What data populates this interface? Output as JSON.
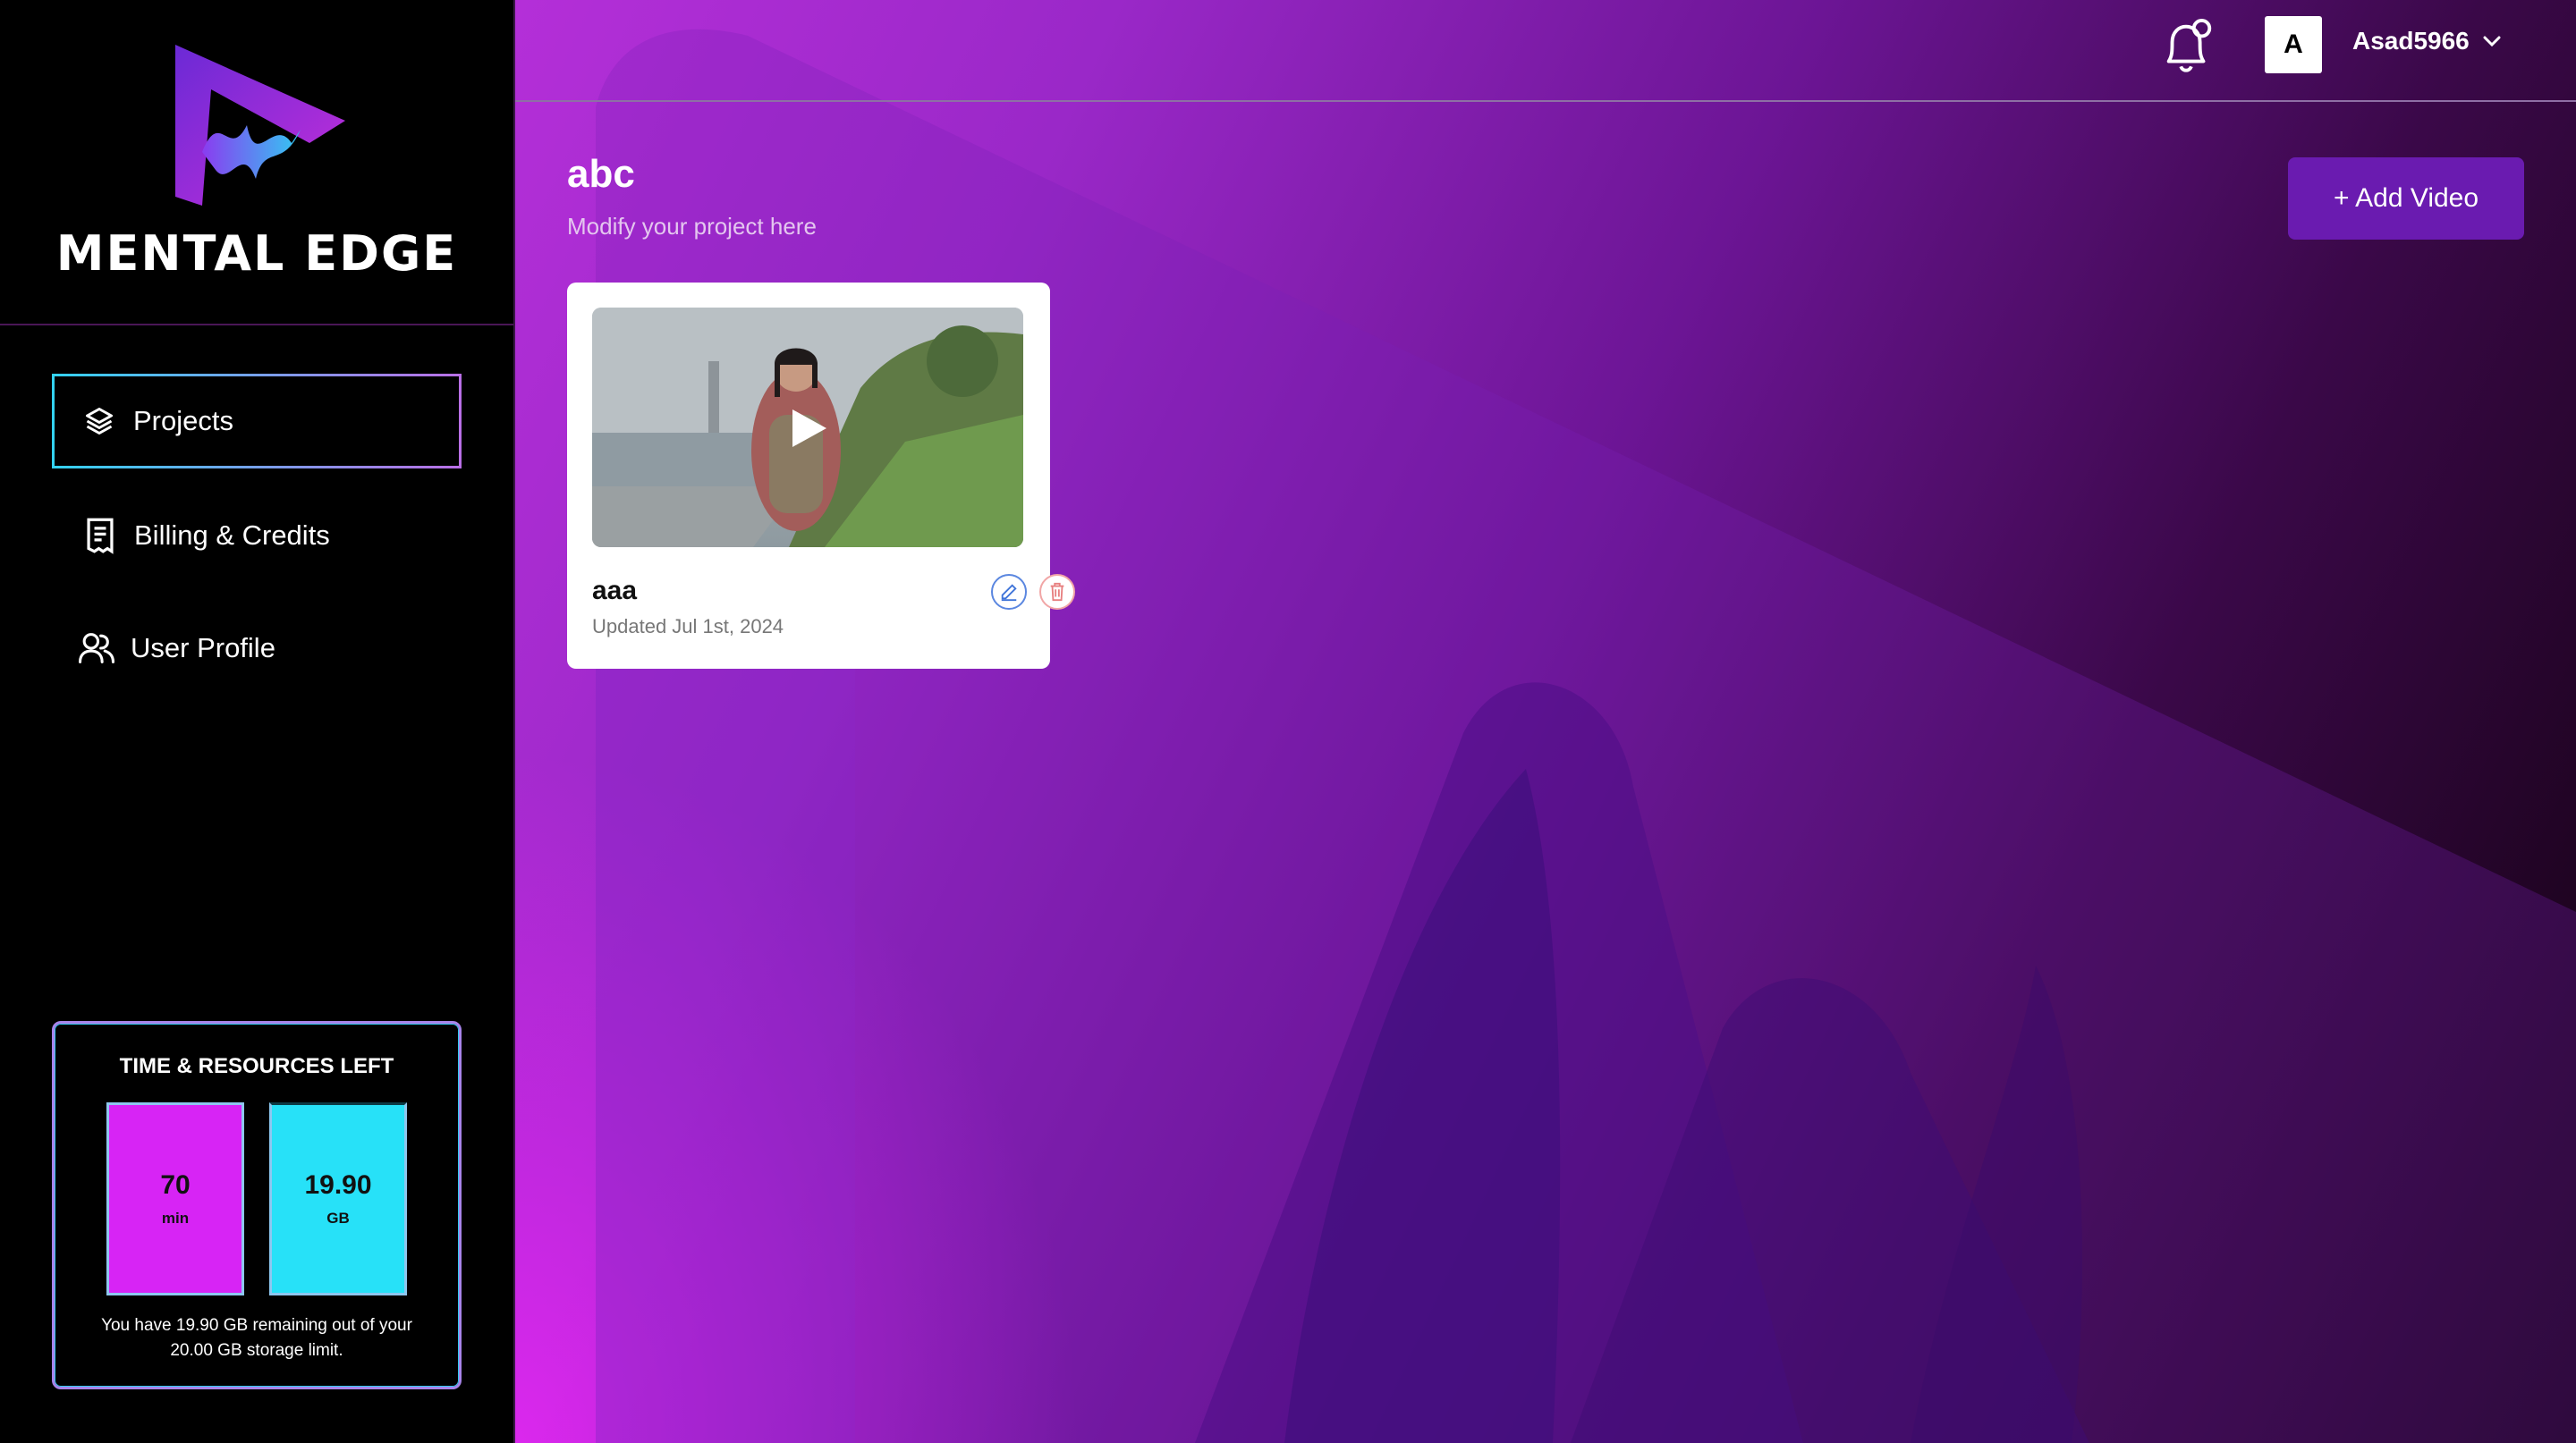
{
  "brand": {
    "name": "MENTAL EDGE"
  },
  "sidebar": {
    "items": [
      {
        "label": "Projects",
        "icon": "layers-icon",
        "active": true
      },
      {
        "label": "Billing & Credits",
        "icon": "receipt-icon",
        "active": false
      },
      {
        "label": "User Profile",
        "icon": "users-icon",
        "active": false
      }
    ]
  },
  "resources": {
    "title": "TIME & RESOURCES LEFT",
    "time": {
      "value": "70",
      "unit": "min"
    },
    "storage": {
      "value": "19.90",
      "unit": "GB"
    },
    "note": "You have 19.90 GB remaining out of your 20.00 GB storage limit."
  },
  "header": {
    "avatar_initial": "A",
    "username": "Asad5966"
  },
  "project": {
    "title": "abc",
    "subtitle": "Modify your project here",
    "add_button": "+ Add Video"
  },
  "videos": [
    {
      "name": "aaa",
      "updated": "Updated Jul 1st, 2024"
    }
  ],
  "colors": {
    "accent_purple": "#6a1bb0",
    "magenta": "#d724f5",
    "cyan": "#27e1f8"
  }
}
